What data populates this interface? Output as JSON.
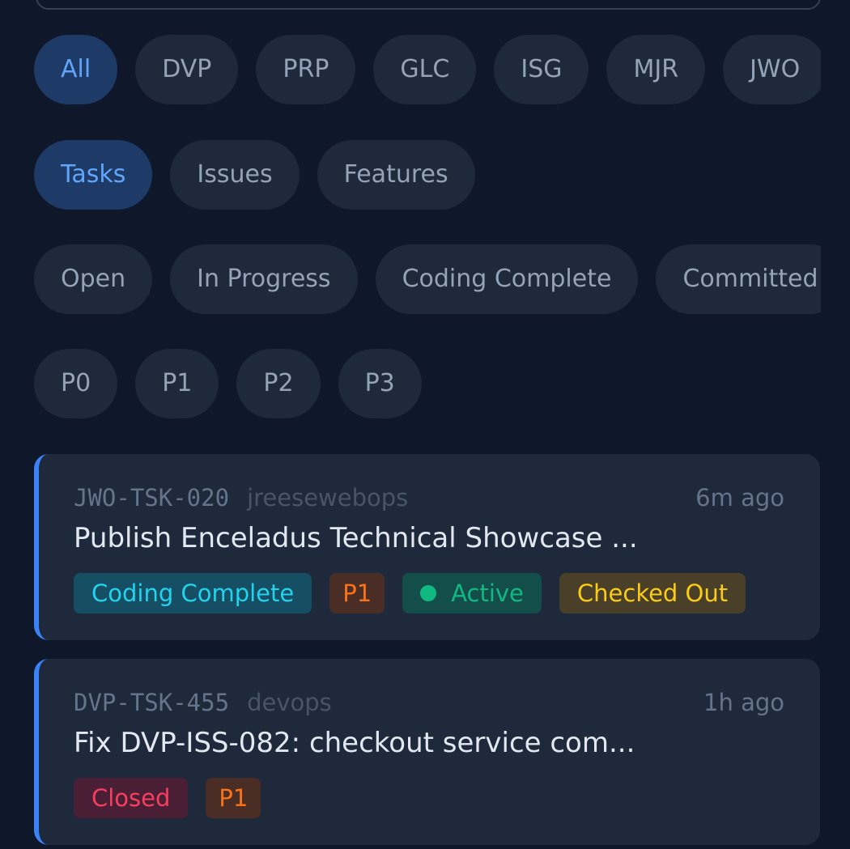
{
  "filters": {
    "projects": [
      "All",
      "DVP",
      "PRP",
      "GLC",
      "ISG",
      "MJR",
      "JWO"
    ],
    "types": [
      "Tasks",
      "Issues",
      "Features"
    ],
    "statuses": [
      "Open",
      "In Progress",
      "Coding Complete",
      "Committed"
    ],
    "priorities": [
      "P0",
      "P1",
      "P2",
      "P3"
    ]
  },
  "tasks": [
    {
      "id": "JWO-TSK-020",
      "owner": "jreesewebops",
      "time": "6m ago",
      "title": "Publish Enceladus Technical Showcase ...",
      "status": "Coding Complete",
      "priority": "P1",
      "active": "Active",
      "checkout": "Checked Out"
    },
    {
      "id": "DVP-TSK-455",
      "owner": "devops",
      "time": "1h ago",
      "title": "Fix DVP-ISS-082: checkout service com...",
      "status": "Closed",
      "priority": "P1"
    }
  ],
  "colors": {
    "background": "#0f172a",
    "card": "#1e293b",
    "accent": "#3b82f6",
    "active_chip_text": "#60a5fa"
  }
}
